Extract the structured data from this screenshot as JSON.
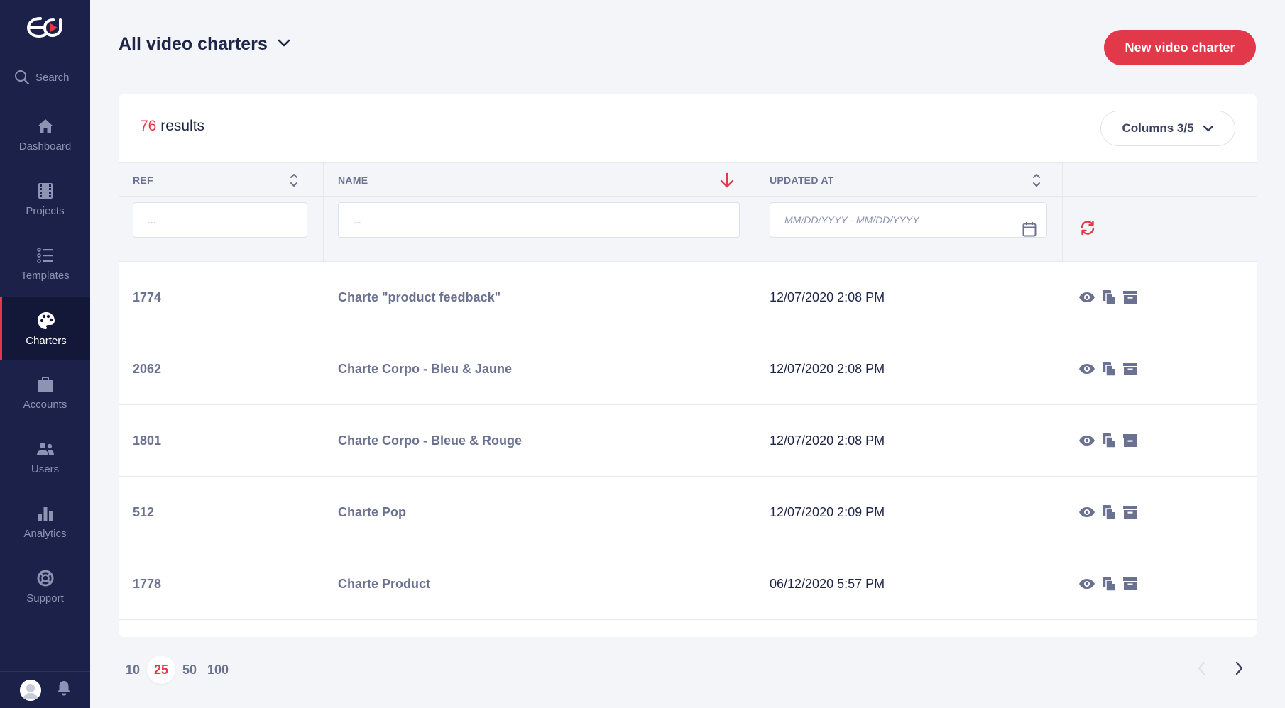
{
  "sidebar": {
    "search_label": "Search",
    "items": [
      {
        "label": "Dashboard",
        "icon": "home-icon"
      },
      {
        "label": "Projects",
        "icon": "film-icon"
      },
      {
        "label": "Templates",
        "icon": "list-icon"
      },
      {
        "label": "Charters",
        "icon": "palette-icon",
        "active": true
      },
      {
        "label": "Accounts",
        "icon": "briefcase-icon"
      },
      {
        "label": "Users",
        "icon": "users-icon"
      },
      {
        "label": "Analytics",
        "icon": "bar-chart-icon"
      },
      {
        "label": "Support",
        "icon": "lifebuoy-icon"
      }
    ]
  },
  "header": {
    "title": "All video charters",
    "new_button": "New video charter"
  },
  "results": {
    "count": "76",
    "label": "results"
  },
  "columns_button": "Columns 3/5",
  "table": {
    "headers": {
      "ref": "REF",
      "name": "NAME",
      "updated_at": "UPDATED AT"
    },
    "filters": {
      "ref_placeholder": "...",
      "name_placeholder": "...",
      "date_placeholder": "MM/DD/YYYY - MM/DD/YYYY"
    },
    "rows": [
      {
        "ref": "1774",
        "name": "Charte \"product feedback\"",
        "updated_at": "12/07/2020 2:08 PM"
      },
      {
        "ref": "2062",
        "name": "Charte Corpo - Bleu & Jaune",
        "updated_at": "12/07/2020 2:08 PM"
      },
      {
        "ref": "1801",
        "name": "Charte Corpo - Bleue & Rouge",
        "updated_at": "12/07/2020 2:08 PM"
      },
      {
        "ref": "512",
        "name": "Charte Pop",
        "updated_at": "12/07/2020 2:09 PM"
      },
      {
        "ref": "1778",
        "name": "Charte Product",
        "updated_at": "06/12/2020 5:57 PM"
      }
    ]
  },
  "pagination": {
    "page_sizes": [
      "10",
      "25",
      "50",
      "100"
    ],
    "selected": "25"
  },
  "colors": {
    "accent": "#e2394a",
    "sidebar": "#1b2148",
    "muted": "#6b7190"
  }
}
